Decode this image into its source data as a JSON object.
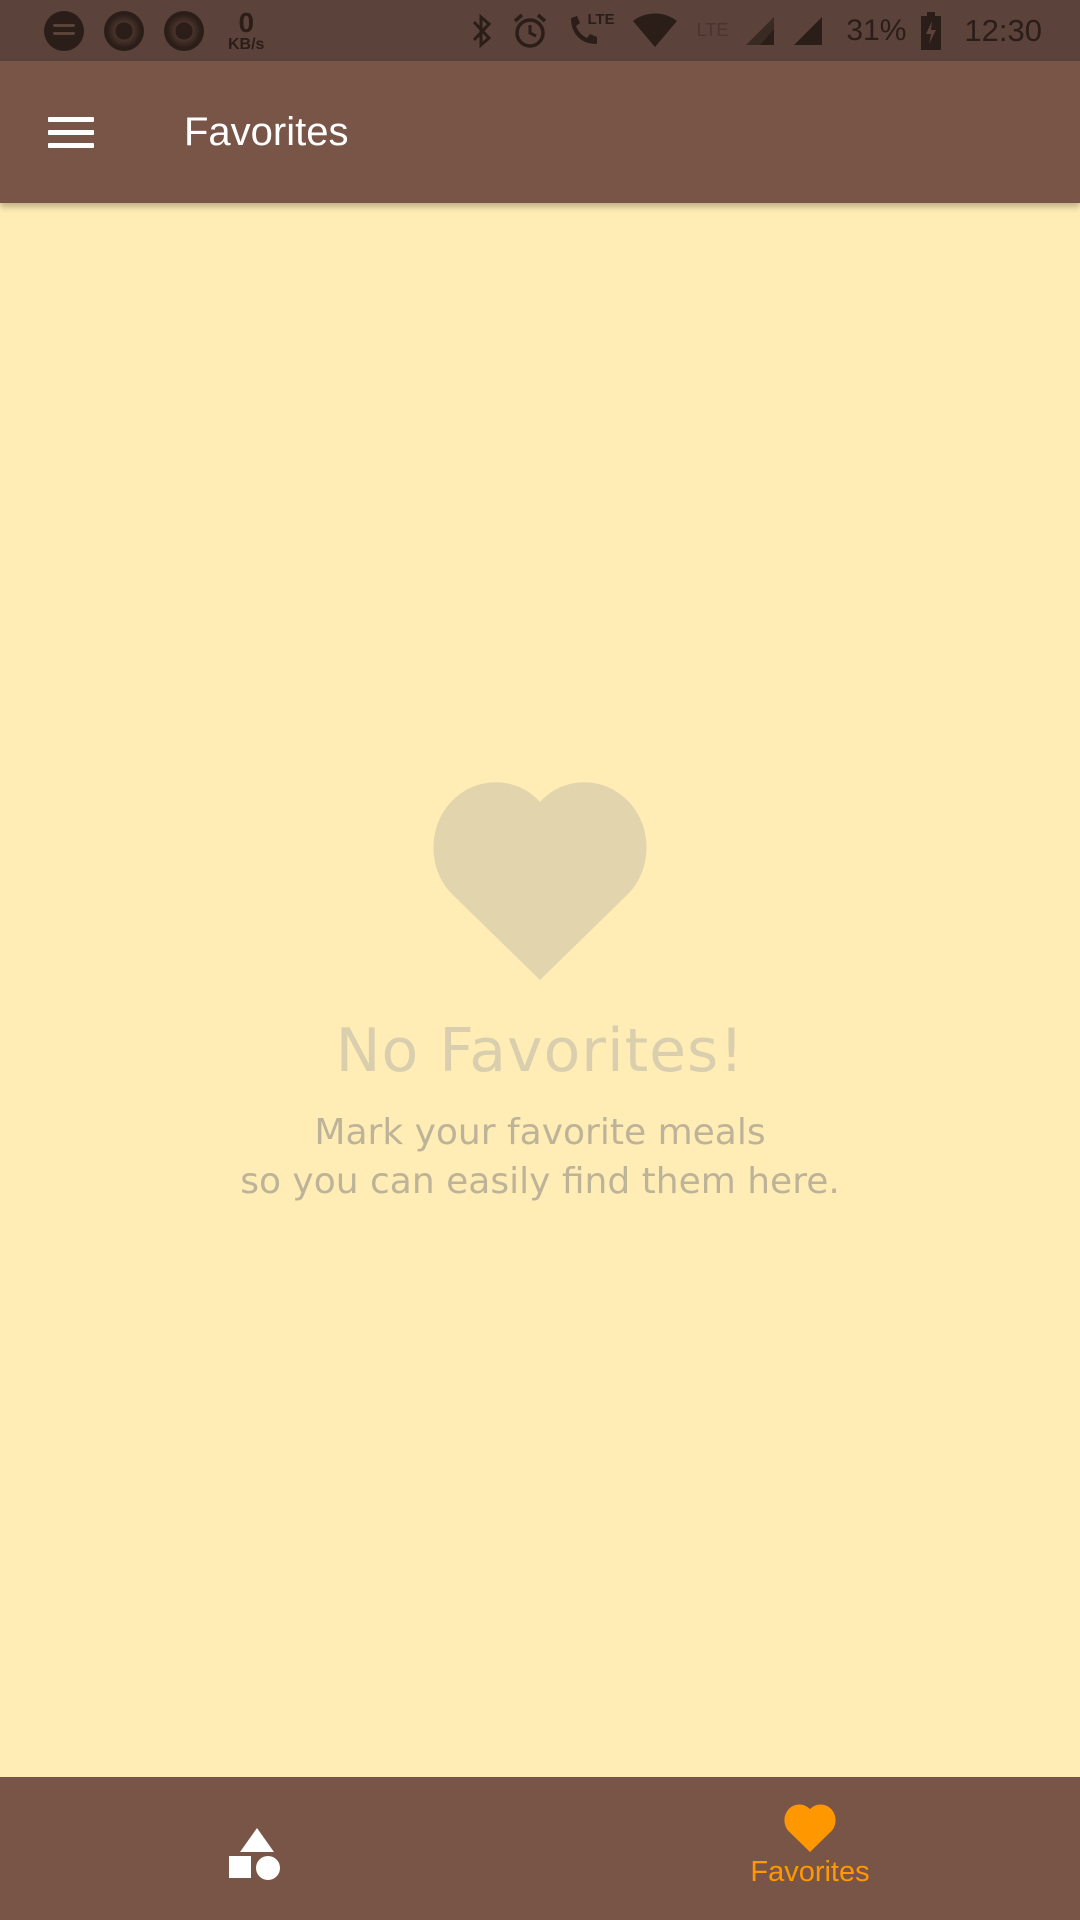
{
  "status_bar": {
    "net_speed_value": "0",
    "net_speed_unit": "KB/s",
    "lte_label_1": "LTE",
    "lte_label_2": "LTE",
    "battery": "31%",
    "time": "12:30"
  },
  "app_bar": {
    "title": "Favorites",
    "menu_icon": "hamburger-menu-icon"
  },
  "empty_state": {
    "icon": "heart-icon",
    "title": "No Favorites!",
    "message": "Mark your favorite meals\nso you can easily find them here."
  },
  "bottom_nav": {
    "items": [
      {
        "icon": "categories-icon",
        "label": "",
        "active": false
      },
      {
        "icon": "heart-icon",
        "label": "Favorites",
        "active": true
      }
    ]
  },
  "colors": {
    "status_bar": "#5B423A",
    "app_bar": "#795548",
    "background": "#FFEDB5",
    "accent": "#FF9800",
    "heart_muted": "#E2D5AD",
    "title_muted": "#D9CFAE",
    "message_muted": "#BDB399"
  }
}
